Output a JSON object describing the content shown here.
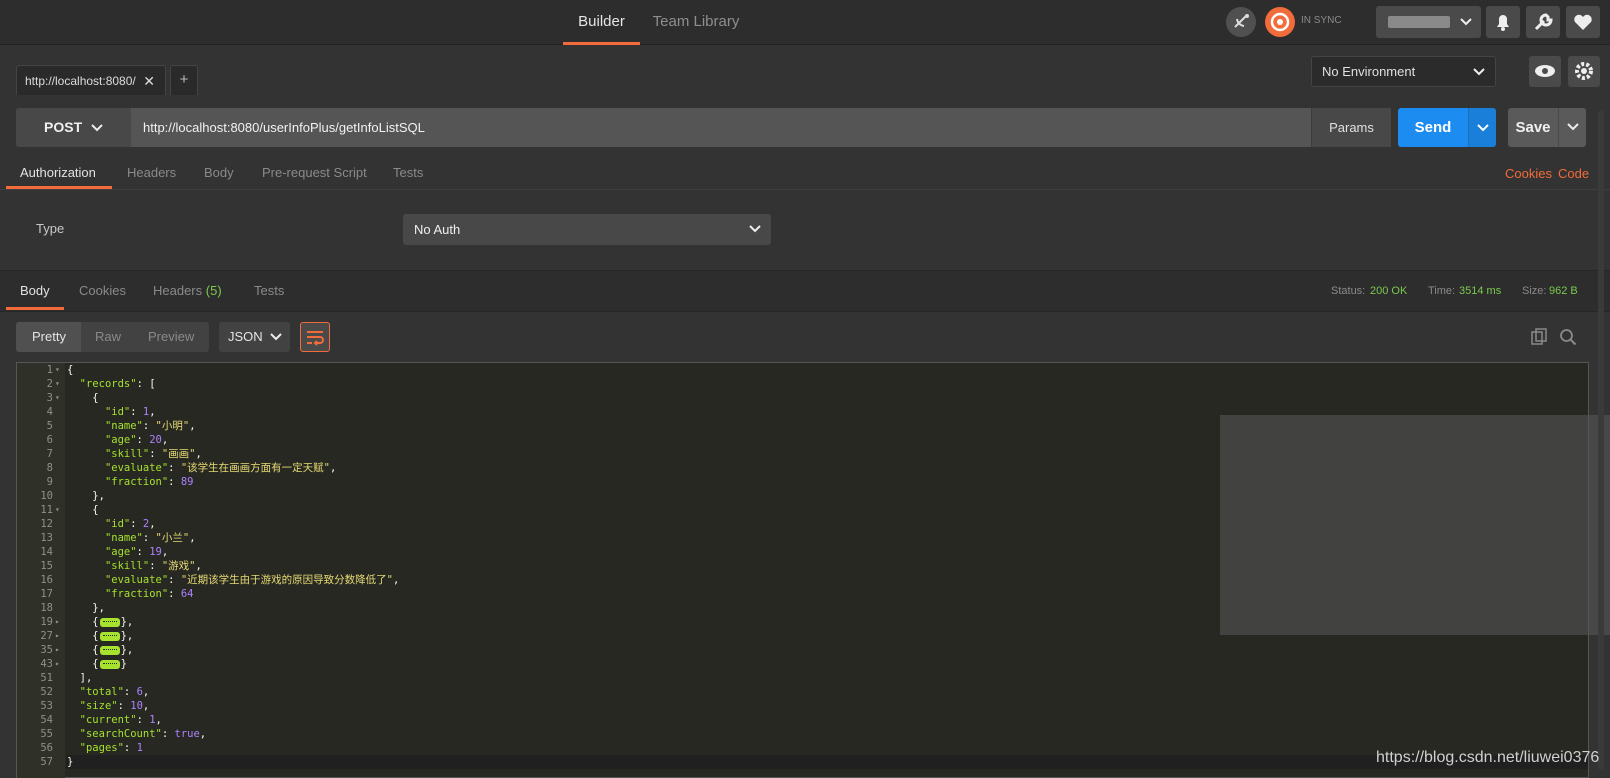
{
  "topbar": {
    "tabs": [
      {
        "label": "Builder"
      },
      {
        "label": "Team Library"
      }
    ],
    "sync_status": "IN SYNC",
    "icons": [
      "satellite-icon",
      "sync-icon",
      "bell-icon",
      "wrench-icon",
      "heart-icon"
    ]
  },
  "request_tabs": {
    "tabs": [
      {
        "label": "http://localhost:8080/"
      }
    ],
    "add_label": "+"
  },
  "environment": {
    "selected": "No Environment"
  },
  "request": {
    "method": "POST",
    "url": "http://localhost:8080/userInfoPlus/getInfoListSQL",
    "params_label": "Params",
    "send_label": "Send",
    "save_label": "Save"
  },
  "request_tabs_nav": {
    "tabs": [
      "Authorization",
      "Headers",
      "Body",
      "Pre-request Script",
      "Tests"
    ],
    "cookies_label": "Cookies",
    "code_label": "Code"
  },
  "auth": {
    "type_label": "Type",
    "selected": "No Auth"
  },
  "response": {
    "tabs": [
      "Body",
      "Cookies",
      "Headers",
      "Tests"
    ],
    "headers_count": "(5)",
    "status_label": "Status:",
    "status_value": "200 OK",
    "time_label": "Time:",
    "time_value": "3514 ms",
    "size_label": "Size:",
    "size_value": "962 B",
    "format_tabs": [
      "Pretty",
      "Raw",
      "Preview"
    ],
    "format_select": "JSON"
  },
  "code_lines": [
    {
      "n": "1",
      "fold": "▾"
    },
    {
      "n": "2",
      "fold": "▾"
    },
    {
      "n": "3",
      "fold": "▾"
    },
    {
      "n": "4"
    },
    {
      "n": "5"
    },
    {
      "n": "6"
    },
    {
      "n": "7"
    },
    {
      "n": "8"
    },
    {
      "n": "9"
    },
    {
      "n": "10"
    },
    {
      "n": "11",
      "fold": "▾"
    },
    {
      "n": "12"
    },
    {
      "n": "13"
    },
    {
      "n": "14"
    },
    {
      "n": "15"
    },
    {
      "n": "16"
    },
    {
      "n": "17"
    },
    {
      "n": "18"
    },
    {
      "n": "19",
      "fold": "▸"
    },
    {
      "n": "27",
      "fold": "▸"
    },
    {
      "n": "35",
      "fold": "▸"
    },
    {
      "n": "43",
      "fold": "▸"
    },
    {
      "n": "51"
    },
    {
      "n": "52"
    },
    {
      "n": "53"
    },
    {
      "n": "54"
    },
    {
      "n": "55"
    },
    {
      "n": "56"
    },
    {
      "n": "57"
    }
  ],
  "json_body": {
    "records": [
      {
        "id": "1",
        "name": "\"小明\"",
        "age": "20",
        "skill": "\"画画\"",
        "evaluate": "\"该学生在画画方面有一定天赋\"",
        "fraction": "89"
      },
      {
        "id": "2",
        "name": "\"小兰\"",
        "age": "19",
        "skill": "\"游戏\"",
        "evaluate": "\"近期该学生由于游戏的原因导致分数降低了\"",
        "fraction": "64"
      }
    ],
    "total": "6",
    "size": "10",
    "current": "1",
    "searchCount": "true",
    "pages": "1"
  },
  "keys": {
    "records": "\"records\"",
    "id": "\"id\"",
    "name": "\"name\"",
    "age": "\"age\"",
    "skill": "\"skill\"",
    "evaluate": "\"evaluate\"",
    "fraction": "\"fraction\"",
    "total": "\"total\"",
    "size": "\"size\"",
    "current": "\"current\"",
    "searchCount": "\"searchCount\"",
    "pages": "\"pages\""
  },
  "watermark": "https://blog.csdn.net/liuwei0376",
  "colors": {
    "accent": "#f26b3a",
    "send": "#1d8cf0",
    "ok": "#7ac94e"
  }
}
